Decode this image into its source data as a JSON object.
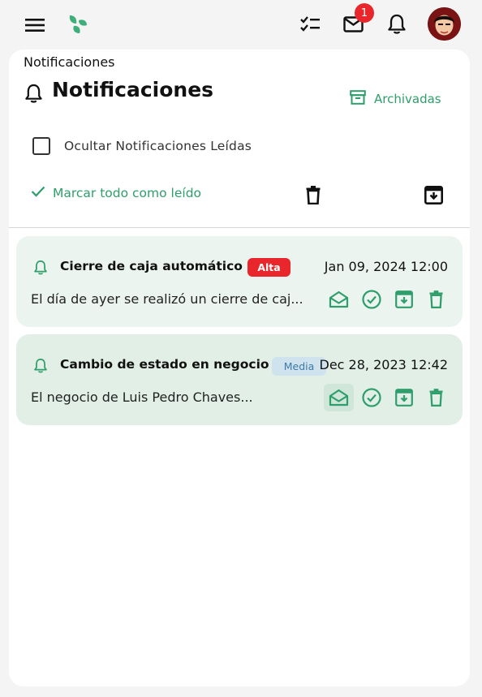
{
  "topbar": {
    "menu_icon": "menu-icon",
    "logo_icon": "leaf-logo-icon",
    "tasks_icon": "checklist-icon",
    "mail_icon": "mail-icon",
    "mail_badge": "1",
    "bell_icon": "bell-icon",
    "avatar_icon": "user-avatar"
  },
  "page": {
    "breadcrumb": "Notificaciones",
    "title": "Notificaciones",
    "archived_label": "Archivadas",
    "hide_read_label": "Ocultar Notificaciones Leídas",
    "mark_all_label": "Marcar todo como leído"
  },
  "notifications": [
    {
      "title": "Cierre de caja automático",
      "priority": "Alta",
      "date": "Jan 09, 2024 12:00",
      "text": "El día de ayer se realizó un cierre de caj..."
    },
    {
      "title": "Cambio de estado en negocio",
      "priority": "Media",
      "date": "Dec 28, 2023 12:42",
      "text": "El negocio de Luis Pedro Chaves..."
    }
  ],
  "colors": {
    "accent": "#2e9e6b",
    "danger": "#e8262b",
    "card_bg": "#ecf4ef",
    "medium_pill": "#cfe3ee"
  }
}
